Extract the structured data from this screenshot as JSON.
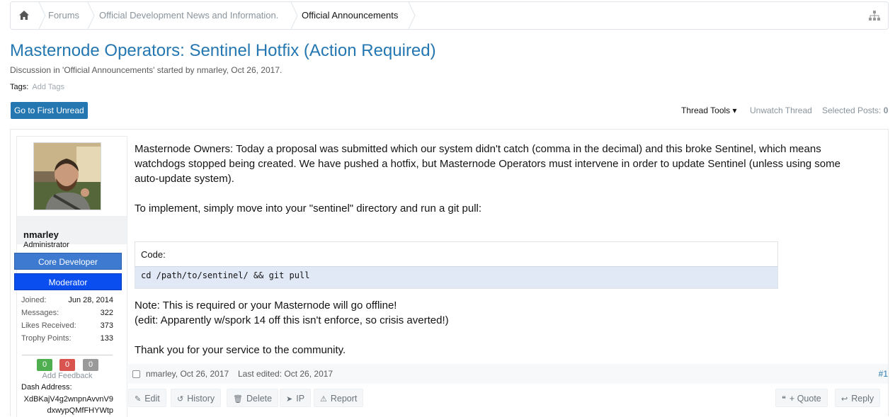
{
  "breadcrumb": {
    "items": [
      "Forums",
      "Official Development News and Information.",
      "Official Announcements"
    ]
  },
  "thread": {
    "title": "Masternode Operators: Sentinel Hotfix (Action Required)",
    "meta": "Discussion in 'Official Announcements' started by nmarley, Oct 26, 2017.",
    "tags_label": "Tags:",
    "add_tags": "Add Tags"
  },
  "buttons": {
    "first_unread": "Go to First Unread"
  },
  "thread_tools": {
    "tools": "Thread Tools",
    "unwatch": "Unwatch Thread",
    "selected_posts": "Selected Posts:",
    "selected_count": "0"
  },
  "user": {
    "name": "nmarley",
    "title": "Administrator",
    "banners": [
      "Core Developer",
      "Moderator"
    ],
    "stats": [
      {
        "k": "Joined:",
        "v": "Jun 28, 2014"
      },
      {
        "k": "Messages:",
        "v": "322"
      },
      {
        "k": "Likes Received:",
        "v": "373"
      },
      {
        "k": "Trophy Points:",
        "v": "133"
      }
    ],
    "feedback": {
      "positive": "0",
      "negative": "0",
      "neutral": "0",
      "add_label": "Add Feedback",
      "colors": {
        "positive": "#4fae4f",
        "negative": "#d9534f",
        "neutral": "#9a9a9a"
      }
    },
    "dash_label": "Dash Address:",
    "dash_address_1": "XdBKajV4g2wnpnAvvnV9",
    "dash_address_2": "dxwypQMfFHYWtp"
  },
  "post": {
    "p1": "Masternode Owners: Today a proposal was submitted which our system didn't catch (comma in the decimal) and this broke Sentinel, which means watchdogs stopped being created. We have pushed a hotfix, but Masternode Operators must intervene in order to update Sentinel (unless using some auto-update system).",
    "p2": "To implement, simply move into your \"sentinel\" directory and run a git pull:",
    "code_label": "Code:",
    "code": "cd /path/to/sentinel/ && git pull",
    "note1": "Note: This is required or your Masternode will go offline!",
    "note2": "(edit: Apparently w/spork 14 off this isn't enforce, so crisis averted!)",
    "thanks": "Thank you for your service to the community.",
    "author_date": "nmarley, Oct 26, 2017",
    "last_edited": "Last edited: Oct 26, 2017",
    "number": "#1"
  },
  "actions": {
    "edit": "Edit",
    "history": "History",
    "delete": "Delete",
    "ip": "IP",
    "report": "Report",
    "quote": "+ Quote",
    "reply": "Reply"
  },
  "icons": [
    "home-icon",
    "sitemap-icon",
    "pencil-icon",
    "history-icon",
    "trash-icon",
    "send-icon",
    "alert-icon",
    "quote-icon",
    "reply-icon",
    "caret-down-icon"
  ],
  "colors": {
    "link": "#2577b1",
    "button": "#2577b1"
  }
}
